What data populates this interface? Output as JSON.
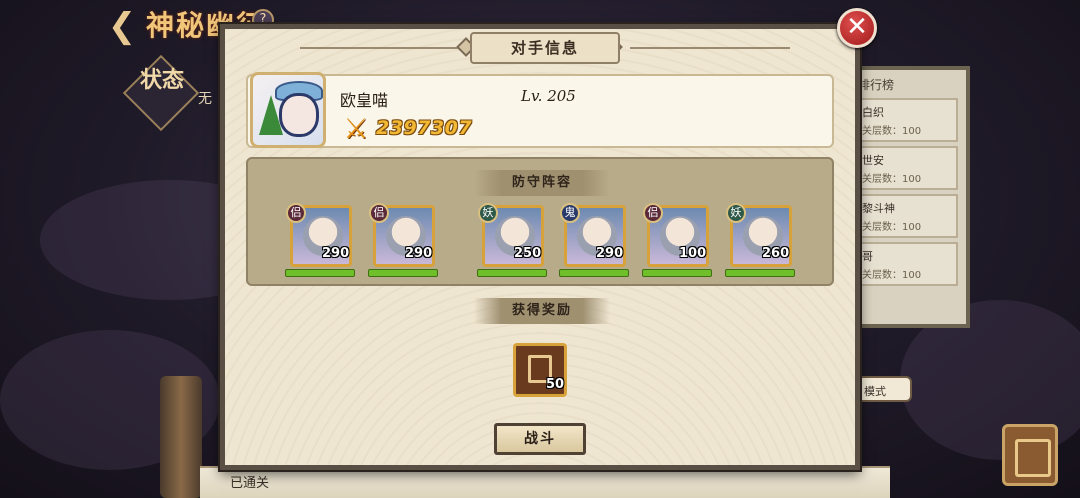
{
  "header": {
    "title": "神秘幽征",
    "help_glyph": "?"
  },
  "status": {
    "label": "状态",
    "side_text": "无"
  },
  "ranking": {
    "title": "排行榜",
    "rows": [
      {
        "name": "白织",
        "sub": "关层数：100"
      },
      {
        "name": "世安",
        "sub": "关层数：100"
      },
      {
        "name": "黎斗神",
        "sub": "关层数：100"
      },
      {
        "name": "哥",
        "sub": "关层数：100"
      }
    ]
  },
  "mode_tag": "模式",
  "bottom": {
    "cleared_label": "已通关"
  },
  "dialog": {
    "title": "对手信息",
    "close_glyph": "✕",
    "player": {
      "name": "欧皇喵",
      "level": "Lv. 205",
      "power": "2397307"
    },
    "lineup_title": "防守阵容",
    "heroes": [
      {
        "tag": "侣",
        "level": "290",
        "hp": 1.0
      },
      {
        "tag": "侣",
        "level": "290",
        "hp": 1.0
      },
      {
        "tag": "妖",
        "level": "250",
        "hp": 1.0
      },
      {
        "tag": "鬼",
        "level": "290",
        "hp": 1.0
      },
      {
        "tag": "侣",
        "level": "100",
        "hp": 1.0
      },
      {
        "tag": "妖",
        "level": "260",
        "hp": 1.0
      }
    ],
    "reward_title": "获得奖励",
    "reward": {
      "count": "50"
    },
    "fight_label": "战斗"
  }
}
